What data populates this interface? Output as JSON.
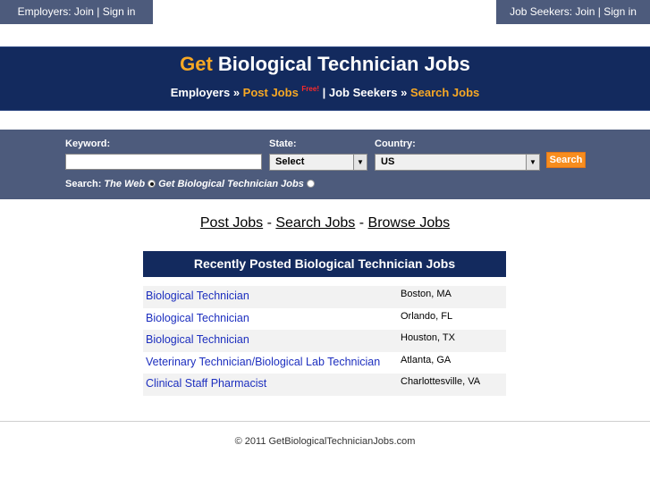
{
  "topbar": {
    "employers_link": "Employers: Join | Sign in",
    "jobseekers_link": "Job Seekers: Join | Sign in"
  },
  "header": {
    "title_get": "Get",
    "title_rest": " Biological Technician Jobs",
    "employers_label": "Employers",
    "sep1": " » ",
    "post_jobs": "Post Jobs",
    "free_badge": "Free!",
    "pipe": " | ",
    "jobseekers_label": "Job Seekers",
    "sep2": " » ",
    "search_jobs": "Search Jobs"
  },
  "search": {
    "keyword_label": "Keyword:",
    "keyword_value": "",
    "state_label": "State:",
    "state_value": "Select",
    "country_label": "Country:",
    "country_value": "US",
    "button_label": "Search",
    "scope_label": "Search:",
    "option_web": "The Web",
    "option_site": "Get Biological Technician Jobs"
  },
  "links": {
    "post_jobs": "Post Jobs",
    "sep1": " - ",
    "search_jobs": "Search Jobs",
    "sep2": " - ",
    "browse_jobs": "Browse Jobs"
  },
  "jobs": {
    "heading": "Recently Posted Biological Technician Jobs",
    "rows": [
      {
        "title": "Biological Technician",
        "location": "Boston, MA"
      },
      {
        "title": "Biological Technician",
        "location": "Orlando, FL"
      },
      {
        "title": "Biological Technician",
        "location": "Houston, TX"
      },
      {
        "title": "Veterinary Technician/Biological Lab Technician",
        "location": "Atlanta, GA"
      },
      {
        "title": "Clinical Staff Pharmacist",
        "location": "Charlottesville, VA"
      }
    ]
  },
  "footer": {
    "copyright": "© 2011 GetBiologicalTechnicianJobs.com"
  },
  "colors": {
    "nav_bg": "#4d5b7c",
    "header_bg": "#132a5e",
    "accent_orange": "#f7a824",
    "link_blue": "#1d2fbf"
  }
}
